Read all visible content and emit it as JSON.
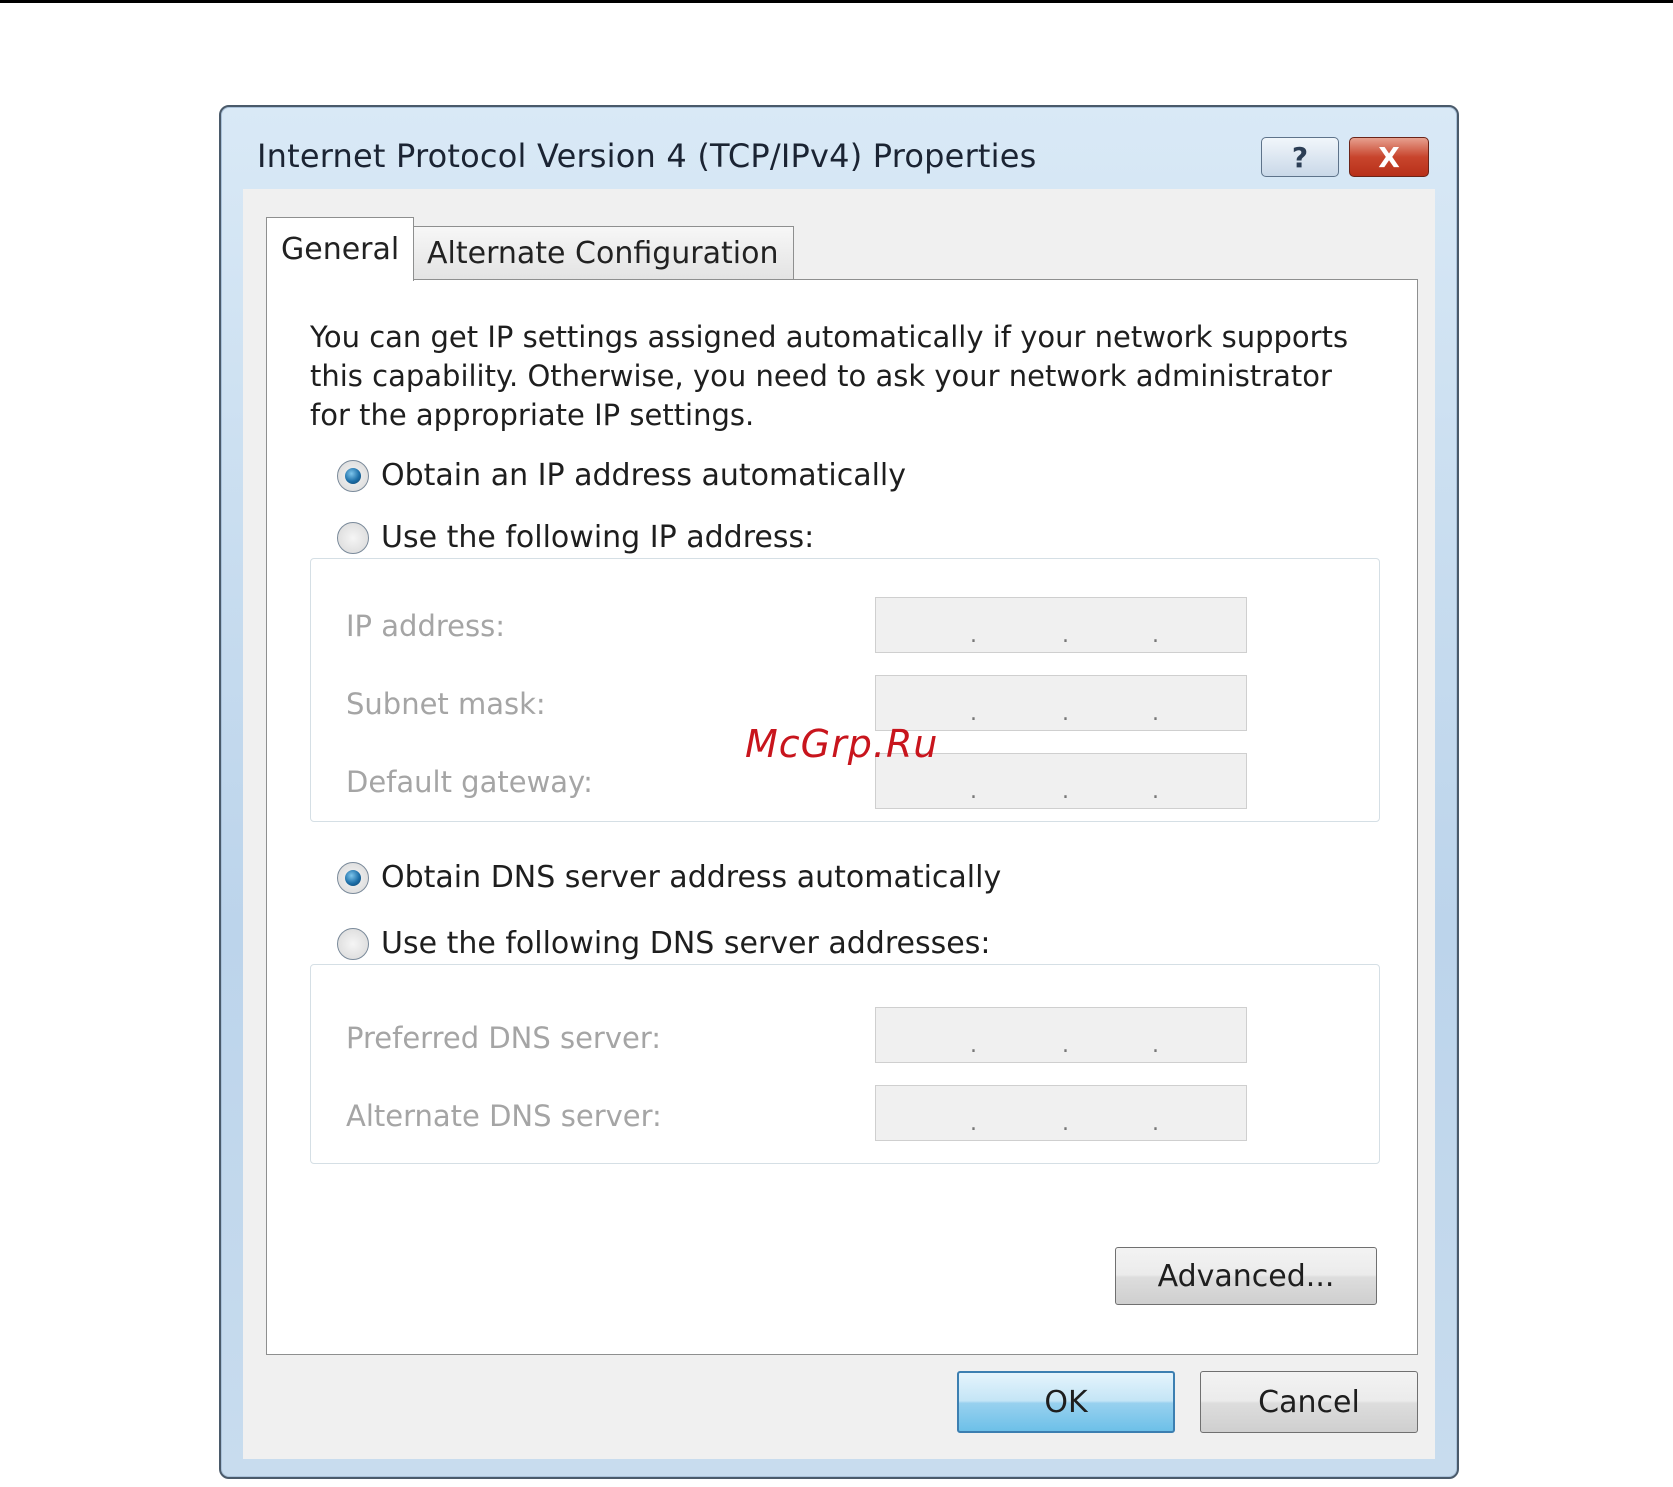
{
  "window": {
    "title": "Internet Protocol Version 4 (TCP/IPv4) Properties",
    "help_label": "?",
    "close_label": "X"
  },
  "tabs": [
    {
      "label": "General",
      "selected": true
    },
    {
      "label": "Alternate Configuration",
      "selected": false
    }
  ],
  "general": {
    "intro_lines": [
      "You can get IP settings assigned automatically if your network supports",
      "this capability. Otherwise, you need to ask your network administrator",
      "for the appropriate IP settings."
    ],
    "ip_mode": {
      "auto_label": "Obtain an IP address automatically",
      "manual_label": "Use the following IP address:",
      "selected": "auto"
    },
    "ip_fields": [
      {
        "label": "IP address:",
        "value": ""
      },
      {
        "label": "Subnet mask:",
        "value": ""
      },
      {
        "label": "Default gateway:",
        "value": ""
      }
    ],
    "dns_mode": {
      "auto_label": "Obtain DNS server address automatically",
      "manual_label": "Use the following DNS server addresses:",
      "selected": "auto"
    },
    "dns_fields": [
      {
        "label": "Preferred DNS server:",
        "value": ""
      },
      {
        "label": "Alternate DNS server:",
        "value": ""
      }
    ],
    "advanced_label": "Advanced..."
  },
  "footer": {
    "ok_label": "OK",
    "cancel_label": "Cancel"
  },
  "ip_separator": ".",
  "watermark": "McGrp.Ru"
}
